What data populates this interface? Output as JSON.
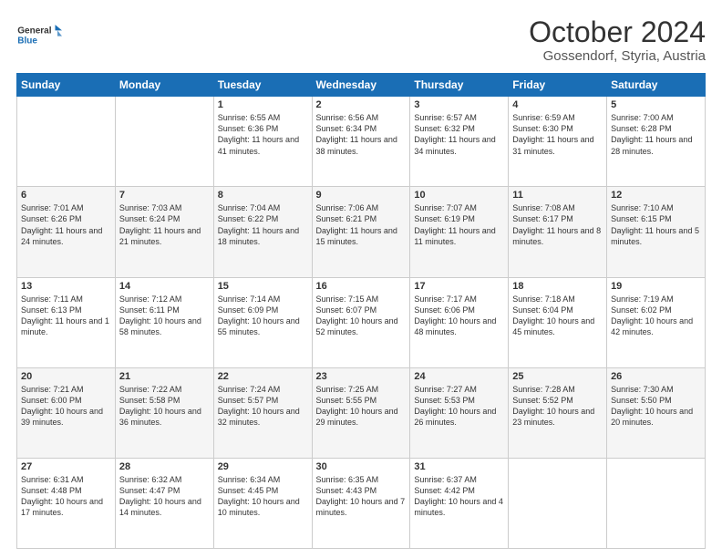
{
  "header": {
    "logo_general": "General",
    "logo_blue": "Blue",
    "month": "October 2024",
    "location": "Gossendorf, Styria, Austria"
  },
  "weekdays": [
    "Sunday",
    "Monday",
    "Tuesday",
    "Wednesday",
    "Thursday",
    "Friday",
    "Saturday"
  ],
  "weeks": [
    [
      {
        "day": "",
        "info": ""
      },
      {
        "day": "",
        "info": ""
      },
      {
        "day": "1",
        "info": "Sunrise: 6:55 AM\nSunset: 6:36 PM\nDaylight: 11 hours and 41 minutes."
      },
      {
        "day": "2",
        "info": "Sunrise: 6:56 AM\nSunset: 6:34 PM\nDaylight: 11 hours and 38 minutes."
      },
      {
        "day": "3",
        "info": "Sunrise: 6:57 AM\nSunset: 6:32 PM\nDaylight: 11 hours and 34 minutes."
      },
      {
        "day": "4",
        "info": "Sunrise: 6:59 AM\nSunset: 6:30 PM\nDaylight: 11 hours and 31 minutes."
      },
      {
        "day": "5",
        "info": "Sunrise: 7:00 AM\nSunset: 6:28 PM\nDaylight: 11 hours and 28 minutes."
      }
    ],
    [
      {
        "day": "6",
        "info": "Sunrise: 7:01 AM\nSunset: 6:26 PM\nDaylight: 11 hours and 24 minutes."
      },
      {
        "day": "7",
        "info": "Sunrise: 7:03 AM\nSunset: 6:24 PM\nDaylight: 11 hours and 21 minutes."
      },
      {
        "day": "8",
        "info": "Sunrise: 7:04 AM\nSunset: 6:22 PM\nDaylight: 11 hours and 18 minutes."
      },
      {
        "day": "9",
        "info": "Sunrise: 7:06 AM\nSunset: 6:21 PM\nDaylight: 11 hours and 15 minutes."
      },
      {
        "day": "10",
        "info": "Sunrise: 7:07 AM\nSunset: 6:19 PM\nDaylight: 11 hours and 11 minutes."
      },
      {
        "day": "11",
        "info": "Sunrise: 7:08 AM\nSunset: 6:17 PM\nDaylight: 11 hours and 8 minutes."
      },
      {
        "day": "12",
        "info": "Sunrise: 7:10 AM\nSunset: 6:15 PM\nDaylight: 11 hours and 5 minutes."
      }
    ],
    [
      {
        "day": "13",
        "info": "Sunrise: 7:11 AM\nSunset: 6:13 PM\nDaylight: 11 hours and 1 minute."
      },
      {
        "day": "14",
        "info": "Sunrise: 7:12 AM\nSunset: 6:11 PM\nDaylight: 10 hours and 58 minutes."
      },
      {
        "day": "15",
        "info": "Sunrise: 7:14 AM\nSunset: 6:09 PM\nDaylight: 10 hours and 55 minutes."
      },
      {
        "day": "16",
        "info": "Sunrise: 7:15 AM\nSunset: 6:07 PM\nDaylight: 10 hours and 52 minutes."
      },
      {
        "day": "17",
        "info": "Sunrise: 7:17 AM\nSunset: 6:06 PM\nDaylight: 10 hours and 48 minutes."
      },
      {
        "day": "18",
        "info": "Sunrise: 7:18 AM\nSunset: 6:04 PM\nDaylight: 10 hours and 45 minutes."
      },
      {
        "day": "19",
        "info": "Sunrise: 7:19 AM\nSunset: 6:02 PM\nDaylight: 10 hours and 42 minutes."
      }
    ],
    [
      {
        "day": "20",
        "info": "Sunrise: 7:21 AM\nSunset: 6:00 PM\nDaylight: 10 hours and 39 minutes."
      },
      {
        "day": "21",
        "info": "Sunrise: 7:22 AM\nSunset: 5:58 PM\nDaylight: 10 hours and 36 minutes."
      },
      {
        "day": "22",
        "info": "Sunrise: 7:24 AM\nSunset: 5:57 PM\nDaylight: 10 hours and 32 minutes."
      },
      {
        "day": "23",
        "info": "Sunrise: 7:25 AM\nSunset: 5:55 PM\nDaylight: 10 hours and 29 minutes."
      },
      {
        "day": "24",
        "info": "Sunrise: 7:27 AM\nSunset: 5:53 PM\nDaylight: 10 hours and 26 minutes."
      },
      {
        "day": "25",
        "info": "Sunrise: 7:28 AM\nSunset: 5:52 PM\nDaylight: 10 hours and 23 minutes."
      },
      {
        "day": "26",
        "info": "Sunrise: 7:30 AM\nSunset: 5:50 PM\nDaylight: 10 hours and 20 minutes."
      }
    ],
    [
      {
        "day": "27",
        "info": "Sunrise: 6:31 AM\nSunset: 4:48 PM\nDaylight: 10 hours and 17 minutes."
      },
      {
        "day": "28",
        "info": "Sunrise: 6:32 AM\nSunset: 4:47 PM\nDaylight: 10 hours and 14 minutes."
      },
      {
        "day": "29",
        "info": "Sunrise: 6:34 AM\nSunset: 4:45 PM\nDaylight: 10 hours and 10 minutes."
      },
      {
        "day": "30",
        "info": "Sunrise: 6:35 AM\nSunset: 4:43 PM\nDaylight: 10 hours and 7 minutes."
      },
      {
        "day": "31",
        "info": "Sunrise: 6:37 AM\nSunset: 4:42 PM\nDaylight: 10 hours and 4 minutes."
      },
      {
        "day": "",
        "info": ""
      },
      {
        "day": "",
        "info": ""
      }
    ]
  ]
}
